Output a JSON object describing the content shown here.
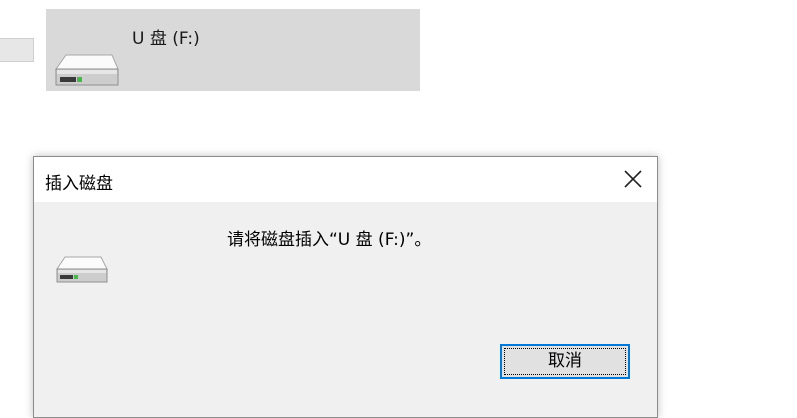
{
  "background_drive": {
    "label": "U 盘 (F:)",
    "icon": "usb-drive-icon",
    "tile_color": "#d9d9d9"
  },
  "dialog": {
    "title": "插入磁盘",
    "message": "请将磁盘插入“U 盘 (F:)”。",
    "icon": "usb-drive-icon",
    "close_icon": "close-icon",
    "cancel_label": "取消",
    "accent_color": "#0078d7"
  }
}
